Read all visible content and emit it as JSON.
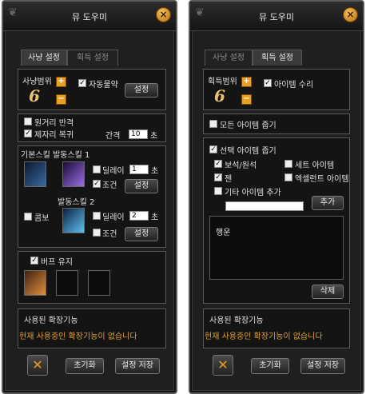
{
  "window": {
    "title": "뮤 도우미",
    "close_icon": "×"
  },
  "tabs": [
    "사냥 설정",
    "획득 설정"
  ],
  "hunting": {
    "range_label": "사냥범위",
    "range_value": "6",
    "auto_potion_label": "자동물약",
    "settings_label": "설정",
    "long_range_counter_label": "원거리 반격",
    "return_to_spot_label": "제자리 복귀",
    "interval_label": "간격",
    "interval_value": "10",
    "interval_unit": "초",
    "basic_skill_label": "기본스킬 발동스킬 1",
    "delay_label": "딜레이",
    "delay1_value": "1",
    "sec_unit": "초",
    "condition_label": "조건",
    "activation_skill2_label": "발동스킬 2",
    "combo_label": "콤보",
    "delay2_value": "2",
    "buff_keep_label": "버프 유지"
  },
  "pickup": {
    "range_label": "획득범위",
    "range_value": "6",
    "item_repair_label": "아이템 수리",
    "all_items_label": "모든 아이템 줍기",
    "selected_items_label": "선택 아이템 줍기",
    "jewel_label": "보석/원석",
    "set_item_label": "세트 아이템",
    "zen_label": "젠",
    "excellent_label": "엑셀런트 아이템",
    "extra_item_label": "기타 아이템 추가",
    "add_label": "추가",
    "item_list": [
      "행운"
    ],
    "delete_label": "삭제"
  },
  "footer": {
    "ext_header": "사용된 확장기능",
    "ext_none": "현재 사용중인 확장기능이 없습니다",
    "reset_label": "초기화",
    "save_label": "설정 저장"
  },
  "colors": {
    "accent": "#e8a020",
    "warning": "#e0a030"
  }
}
